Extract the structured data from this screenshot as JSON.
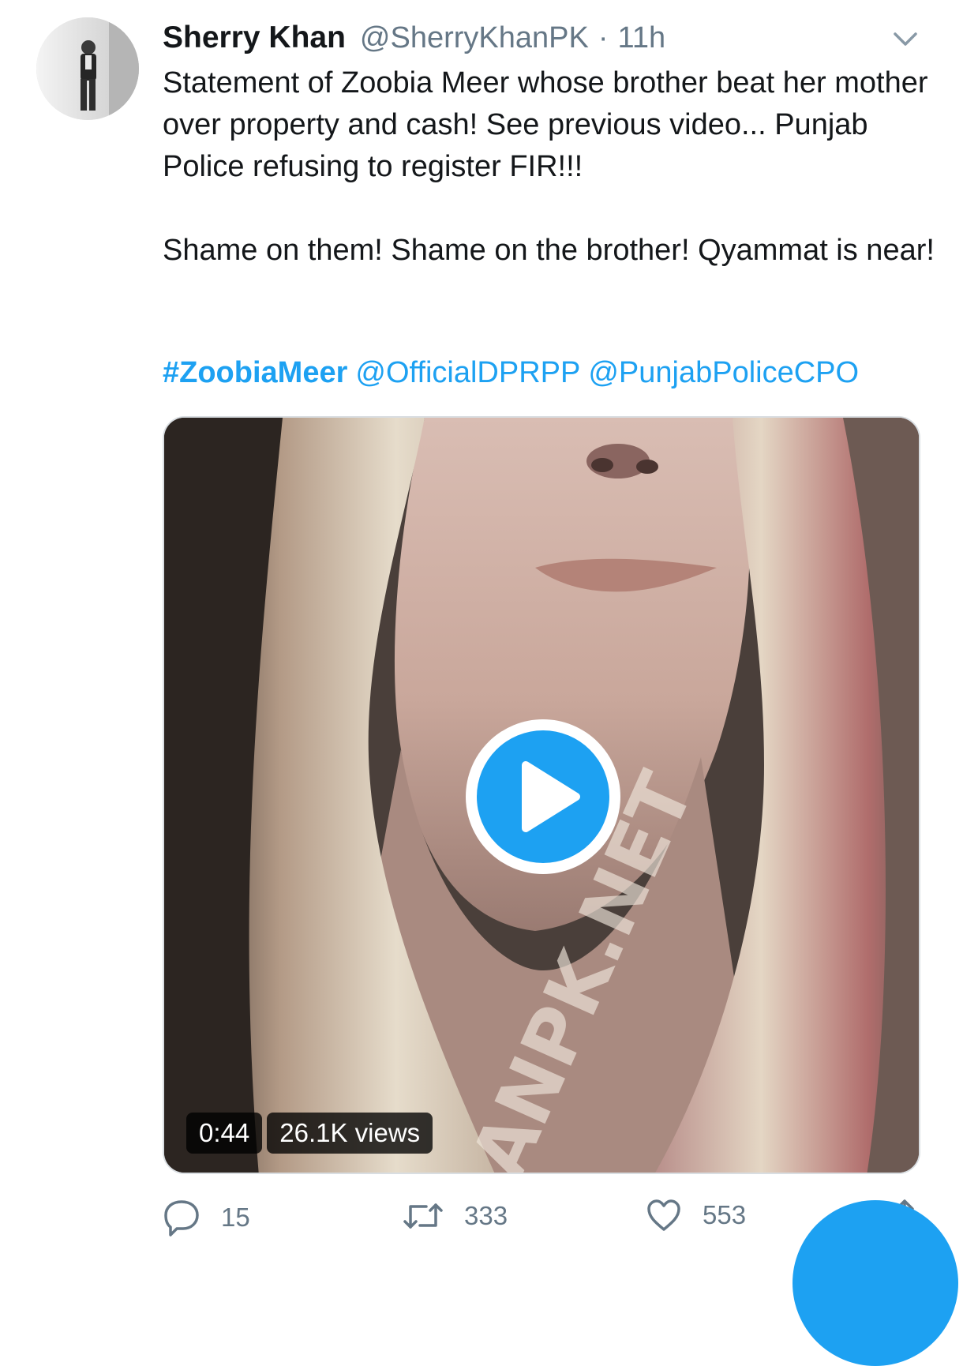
{
  "tweet": {
    "author_name": "Sherry Khan",
    "author_handle": "@SherryKhanPK",
    "separator": "·",
    "timestamp": "11h",
    "text_line1": "Statement of Zoobia Meer whose brother beat her mother over property and cash! See previous video... Punjab Police refusing to register FIR!!!",
    "text_line2": "Shame on them! Shame on the brother! Qyammat is near!",
    "hashtag": "#ZoobiaMeer",
    "mention1": "@OfficialDPRPP",
    "mention2": "@PunjabPoliceCPO"
  },
  "video": {
    "duration": "0:44",
    "views": "26.1K views",
    "watermark": "ANPK.NET"
  },
  "actions": {
    "replies": "15",
    "retweets": "333",
    "likes": "553"
  },
  "icons": {
    "caret": "chevron-down-icon",
    "reply": "reply-icon",
    "retweet": "retweet-icon",
    "like": "heart-icon",
    "share": "share-icon",
    "play": "play-icon"
  },
  "colors": {
    "accent": "#1da1f2",
    "secondary_text": "#657786",
    "primary_text": "#14171a"
  }
}
